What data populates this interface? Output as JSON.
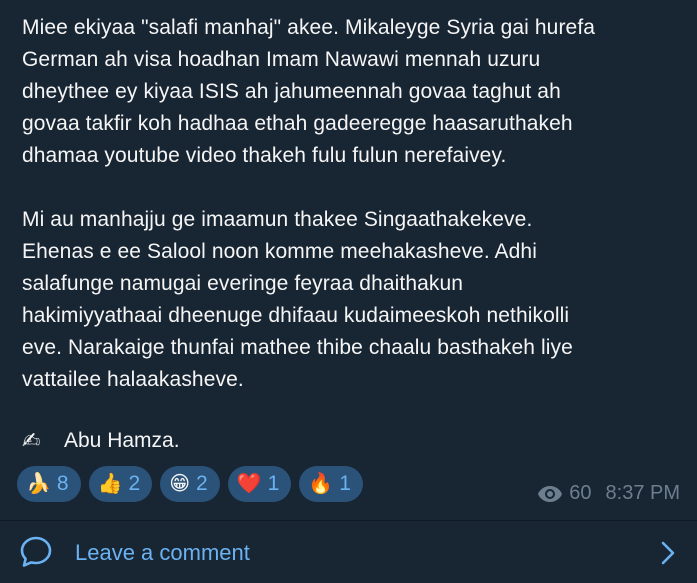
{
  "post": {
    "paragraphs": [
      "Miee ekiyaa \"salafi manhaj\" akee. Mikaleyge Syria gai hurefa\nGerman ah visa hoadhan Imam Nawawi mennah uzuru\ndheythee ey kiyaa ISIS ah jahumeennah govaa taghut ah\ngovaa takfir koh hadhaa ethah gadeeregge haasaruthakeh\ndhamaa youtube video thakeh fulu fulun nerefaivey.",
      "Mi au manhajju ge imaamun thakee Singaathakekeve.\nEhenas e ee Salool noon komme meehakasheve. Adhi\nsalafunge namugai everinge feyraa dhaithakun\nhakimiyyathaai dheenuge dhifaau kudaimeeskoh nethikolli\neve. Narakaige thunfai mathee thibe chaalu basthakeh liye\nvattailee halaakasheve."
    ],
    "signature_emoji": "✍",
    "signature": "Abu Hamza."
  },
  "reactions": [
    {
      "emoji": "🍌",
      "count": "8"
    },
    {
      "emoji": "👍",
      "count": "2"
    },
    {
      "emoji": "😁",
      "count": "2"
    },
    {
      "emoji": "❤️",
      "count": "1"
    },
    {
      "emoji": "🔥",
      "count": "1"
    }
  ],
  "meta": {
    "views": "60",
    "time": "8:37 PM"
  },
  "comment": {
    "label": "Leave a comment"
  },
  "colors": {
    "background": "#182533",
    "accent": "#6ab2f2",
    "reaction_bg": "#2b5278",
    "meta_text": "#6d7f8f"
  },
  "icons": {
    "views": "eye-icon",
    "comment": "comment-bubble-icon",
    "chevron": "chevron-right-icon",
    "signature": "writing-hand-icon"
  }
}
